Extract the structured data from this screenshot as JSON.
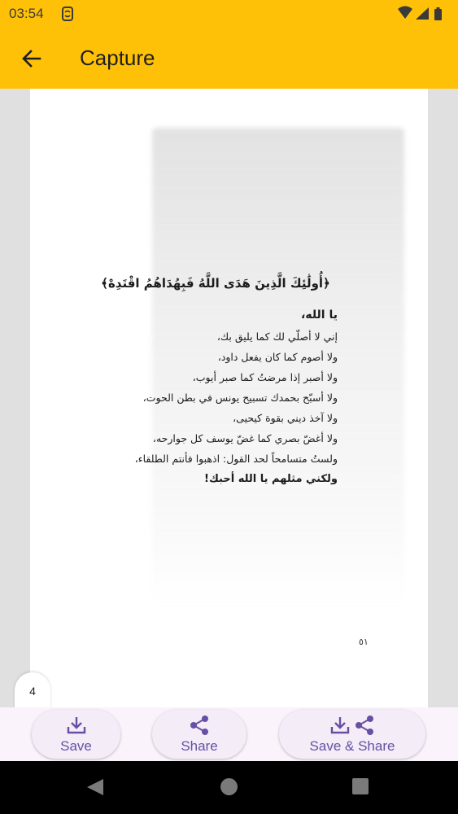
{
  "status_bar": {
    "time": "03:54",
    "icons": [
      "app-notification-icon",
      "wifi-icon",
      "signal-icon",
      "battery-icon"
    ]
  },
  "app_bar": {
    "back_icon": "arrow-back-icon",
    "title": "Capture"
  },
  "document": {
    "verse": "﴿أُولَٰئِكَ الَّذِينَ هَدَى اللَّهُ فَبِهُدَاهُمُ اقْتَدِهْ﴾",
    "heading": "يا الله،",
    "lines": [
      "إني لا أصلّي لك كما يليق بك،",
      "ولا أصوم كما كان يفعل داود،",
      "ولا أصبر إذا مرضتُ كما صبر أيوب،",
      "ولا أسبّح بحمدك تسبيح يونس في بطن الحوت،",
      "ولا آخذ ديني بقوة كيحيى،",
      "ولا أغضّ بصري كما غضّ يوسف كل جوارحه،",
      "ولستُ متسامحاً لحد القول: اذهبوا فأنتم الطلقاء،",
      "ولكني مثلهم يا الله أحبك!"
    ],
    "page_number": "٥١"
  },
  "page_indicator": "4",
  "actions": {
    "save_label": "Save",
    "share_label": "Share",
    "save_share_label": "Save & Share"
  },
  "colors": {
    "app_bar": "#ffc107",
    "accent": "#6750a4",
    "action_bar_bg": "#fbf3fb"
  }
}
